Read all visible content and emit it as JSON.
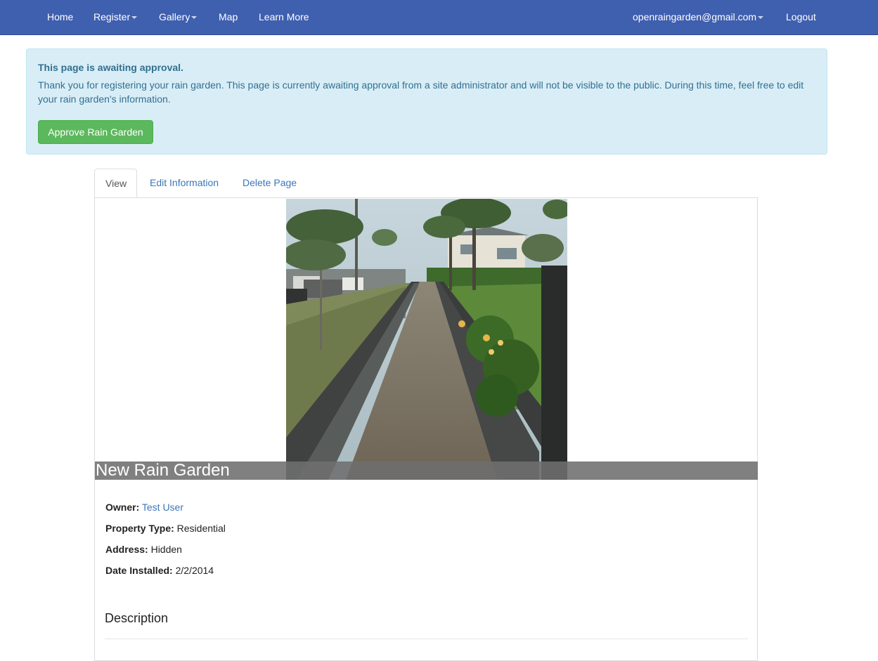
{
  "navbar": {
    "items": [
      {
        "label": "Home",
        "dropdown": false
      },
      {
        "label": "Register",
        "dropdown": true
      },
      {
        "label": "Gallery",
        "dropdown": true
      },
      {
        "label": "Map",
        "dropdown": false
      },
      {
        "label": "Learn More",
        "dropdown": false
      }
    ],
    "user_email": "openraingarden@gmail.com",
    "logout_label": "Logout",
    "background": "#3f5faf"
  },
  "alert": {
    "title": "This page is awaiting approval.",
    "body": "Thank you for registering your rain garden. This page is currently awaiting approval from a site administrator and will not be visible to the public. During this time, feel free to edit your rain garden's information.",
    "approve_label": "Approve Rain Garden"
  },
  "tabs": [
    {
      "label": "View",
      "active": true
    },
    {
      "label": "Edit Information",
      "active": false
    },
    {
      "label": "Delete Page",
      "active": false
    }
  ],
  "garden": {
    "title": "New Rain Garden",
    "fields": {
      "owner_label": "Owner:",
      "owner_value": "Test User",
      "property_type_label": "Property Type:",
      "property_type_value": "Residential",
      "address_label": "Address:",
      "address_value": "Hidden",
      "date_installed_label": "Date Installed:",
      "date_installed_value": "2/2/2014"
    },
    "description_heading": "Description"
  },
  "colors": {
    "approve_button": "#5cb85c",
    "alert_background": "#d9edf7",
    "alert_text": "#31708f",
    "link": "#3a76b8"
  }
}
